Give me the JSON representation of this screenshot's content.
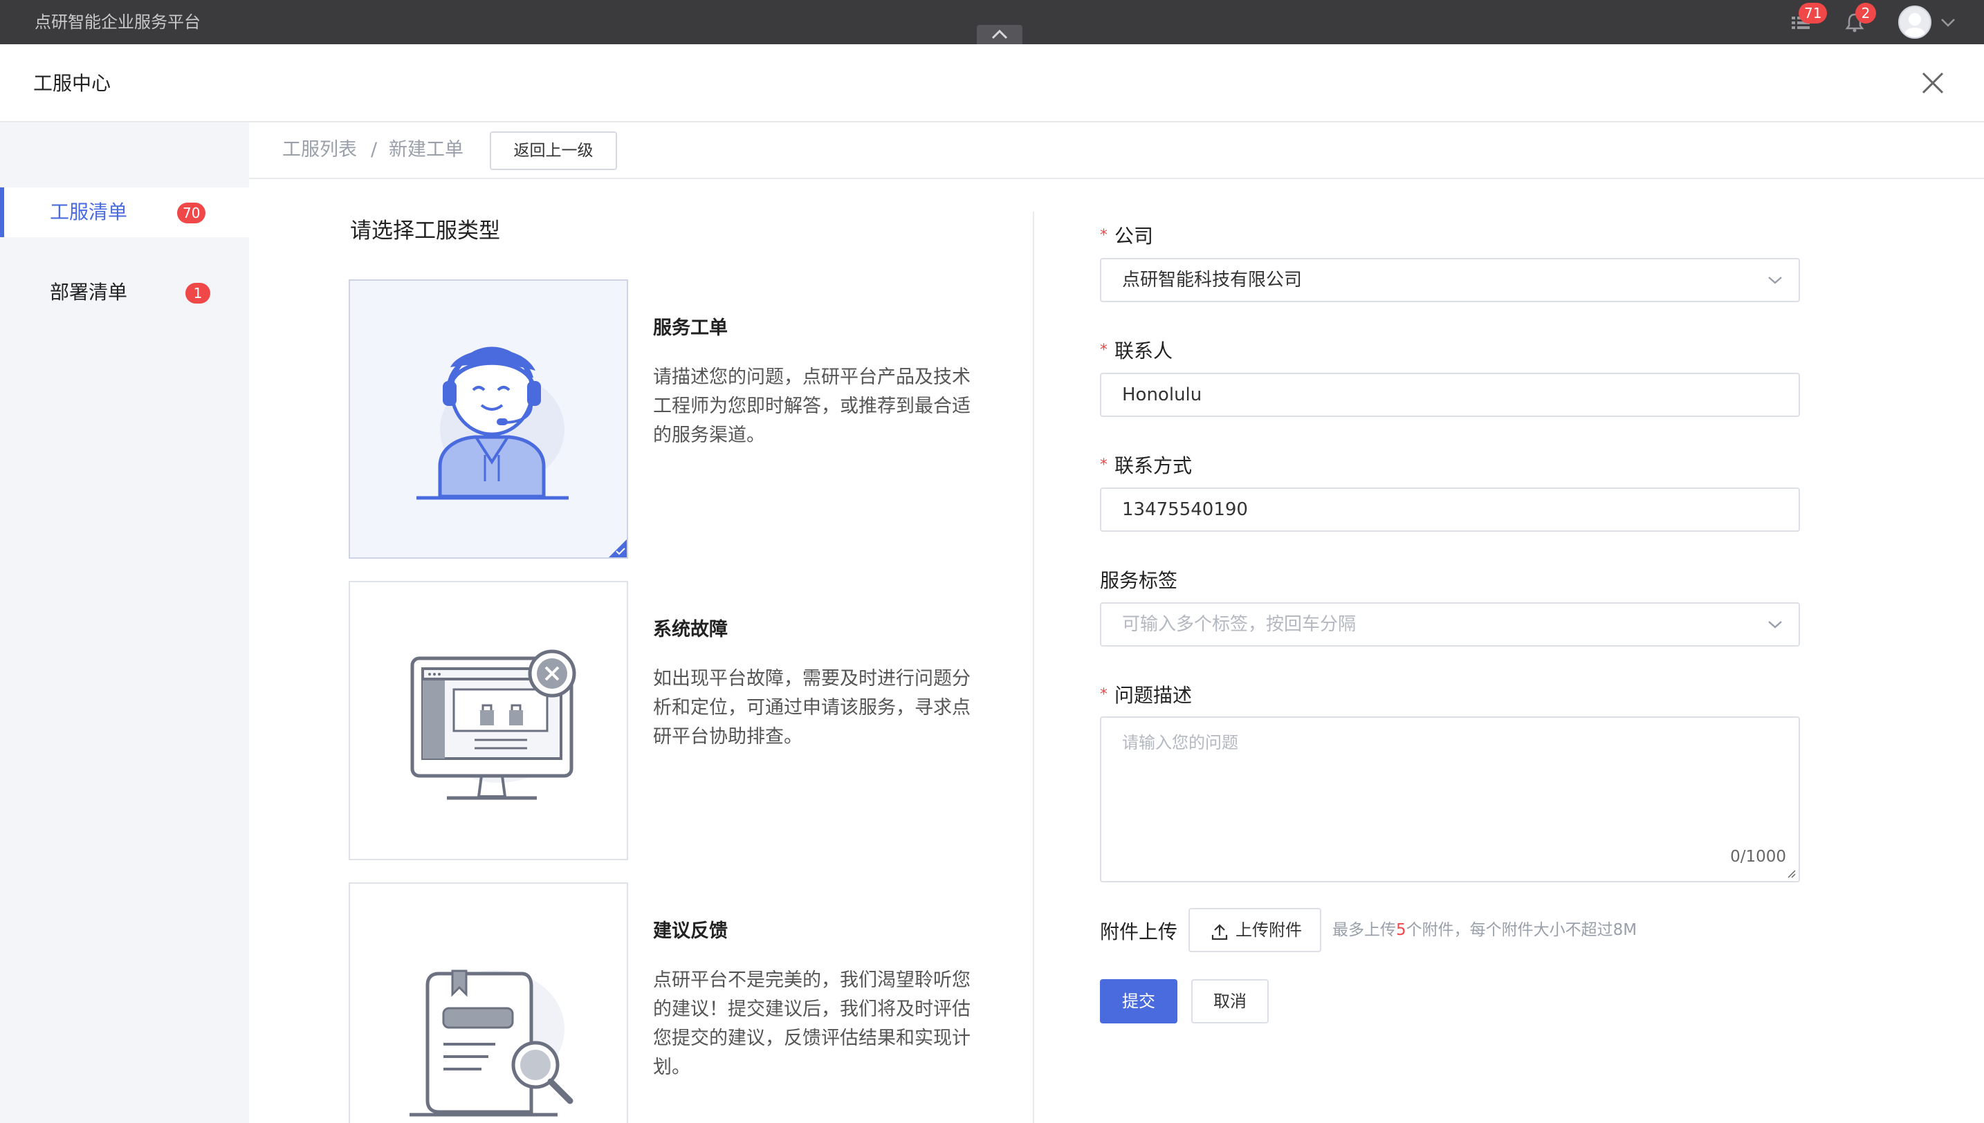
{
  "topbar": {
    "app_title": "点研智能企业服务平台",
    "list_badge": "71",
    "bell_badge": "2",
    "icons": [
      "list-icon",
      "bell-icon",
      "user-avatar",
      "chevron-down-icon",
      "collapse-up-icon"
    ]
  },
  "header": {
    "title": "工服中心"
  },
  "sidebar": {
    "items": [
      {
        "label": "工服清单",
        "badge": "70",
        "active": true
      },
      {
        "label": "部署清单",
        "badge": "1",
        "active": false
      }
    ]
  },
  "breadcrumb": {
    "items": [
      "工服列表",
      "新建工单"
    ],
    "separator": "/",
    "back_label": "返回上一级"
  },
  "types": {
    "section_title": "请选择工服类型",
    "cards": [
      {
        "title": "服务工单",
        "desc": "请描述您的问题，点研平台产品及技术工程师为您即时解答，或推荐到最合适的服务渠道。",
        "selected": true,
        "icon": "support-agent-illustration"
      },
      {
        "title": "系统故障",
        "desc": "如出现平台故障，需要及时进行问题分析和定位，可通过申请该服务，寻求点研平台协助排查。",
        "selected": false,
        "icon": "monitor-error-illustration"
      },
      {
        "title": "建议反馈",
        "desc": "点研平台不是完美的，我们渴望聆听您的建议！提交建议后，我们将及时评估您提交的建议，反馈评估结果和实现计划。",
        "selected": false,
        "icon": "document-search-illustration"
      }
    ]
  },
  "form": {
    "company": {
      "label": "公司",
      "value": "点研智能科技有限公司",
      "required": true
    },
    "contact": {
      "label": "联系人",
      "value": "Honolulu",
      "required": true
    },
    "phone": {
      "label": "联系方式",
      "value": "13475540190",
      "required": true
    },
    "tags": {
      "label": "服务标签",
      "placeholder": "可输入多个标签，按回车分隔",
      "required": false
    },
    "description": {
      "label": "问题描述",
      "placeholder": "请输入您的问题",
      "counter": "0/1000",
      "required": true
    },
    "attachment": {
      "label": "附件上传",
      "button": "上传附件",
      "hint_prefix": "最多上传",
      "hint_count": "5",
      "hint_suffix": "个附件，每个附件大小不超过8M"
    },
    "submit_label": "提交",
    "cancel_label": "取消",
    "required_mark": "*"
  },
  "colors": {
    "accent": "#4a6bde",
    "badge": "#f04848",
    "topbar": "#3b3b3e",
    "sidebar": "#f3f5f8"
  }
}
